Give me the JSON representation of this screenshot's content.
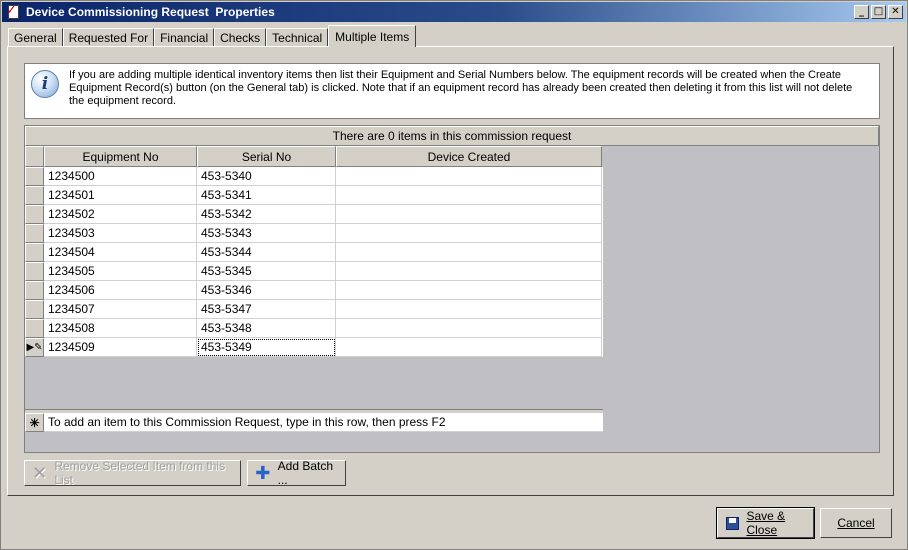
{
  "window": {
    "title": "Device Commissioning Request  Properties",
    "controls": {
      "minimize": "_",
      "maximize": "□",
      "close": "✕"
    }
  },
  "tabs": [
    {
      "label": "General",
      "active": false
    },
    {
      "label": "Requested For",
      "active": false
    },
    {
      "label": "Financial",
      "active": false
    },
    {
      "label": "Checks",
      "active": false
    },
    {
      "label": "Technical",
      "active": false
    },
    {
      "label": "Multiple Items",
      "active": true
    }
  ],
  "info": {
    "icon": "info-icon",
    "icon_glyph": "i",
    "text": "If you are adding multiple identical inventory items then list their Equipment and Serial Numbers below. The equipment records will be created when the Create Equipment Record(s) button (on the General tab) is clicked. Note that if an equipment record has already been created then deleting it from this list will not delete the equipment record."
  },
  "grid": {
    "caption": "There are 0 items in this commission request",
    "columns": [
      "Equipment No",
      "Serial No",
      "Device Created"
    ],
    "rows": [
      {
        "equipment_no": "1234500",
        "serial_no": "453-5340",
        "device_created": ""
      },
      {
        "equipment_no": "1234501",
        "serial_no": "453-5341",
        "device_created": ""
      },
      {
        "equipment_no": "1234502",
        "serial_no": "453-5342",
        "device_created": ""
      },
      {
        "equipment_no": "1234503",
        "serial_no": "453-5343",
        "device_created": ""
      },
      {
        "equipment_no": "1234504",
        "serial_no": "453-5344",
        "device_created": ""
      },
      {
        "equipment_no": "1234505",
        "serial_no": "453-5345",
        "device_created": ""
      },
      {
        "equipment_no": "1234506",
        "serial_no": "453-5346",
        "device_created": ""
      },
      {
        "equipment_no": "1234507",
        "serial_no": "453-5347",
        "device_created": ""
      },
      {
        "equipment_no": "1234508",
        "serial_no": "453-5348",
        "device_created": ""
      },
      {
        "equipment_no": "1234509",
        "serial_no": "453-5349",
        "device_created": ""
      }
    ],
    "current_row_indicator": "▶✎",
    "new_row_indicator": "✳",
    "new_row_hint": "To add an item to this Commission Request, type in this row, then press F2"
  },
  "buttons": {
    "remove": {
      "label": "Remove Selected Item from this List",
      "icon": "x-icon",
      "glyph": "✕",
      "enabled": false
    },
    "add_batch": {
      "label": "Add Batch ...",
      "icon": "plus-icon",
      "glyph": "✚",
      "enabled": true
    },
    "save_close": {
      "label": "Save & Close",
      "icon": "floppy-disk-icon"
    },
    "cancel": {
      "label": "Cancel"
    }
  },
  "colors": {
    "title_bar_start": "#0a246a",
    "title_bar_end": "#a6caf0",
    "face": "#d4d0c8",
    "grid_empty_area": "#c0bfc3"
  }
}
